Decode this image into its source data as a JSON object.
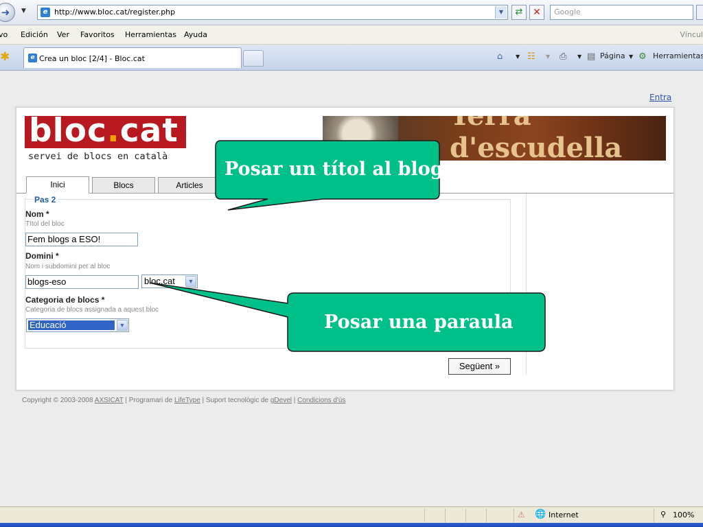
{
  "browser": {
    "url": "http://www.bloc.cat/register.php",
    "search_placeholder": "Google",
    "menu": [
      "vo",
      "Edición",
      "Ver",
      "Favoritos",
      "Herramientas",
      "Ayuda"
    ],
    "menu_right": "Víncul",
    "tab_title": "Crea un bloc [2/4] - Bloc.cat",
    "cmd_page": "Página",
    "cmd_tools": "Herramientas"
  },
  "site": {
    "login_link": "Entra",
    "logo_part1": "bloc",
    "logo_dot": ".",
    "logo_part2": "cat",
    "logo_sub": "servei de blocs en català",
    "banner_text": "Terra d'escudella",
    "nav_tabs": [
      "Inici",
      "Blocs",
      "Articles"
    ]
  },
  "form": {
    "legend": "Pas 2",
    "nom_label": "Nom *",
    "nom_hint": "Títol del bloc",
    "nom_value": "Fem blogs a ESO!",
    "domini_label": "Domini *",
    "domini_hint": "Nom i subdomini per al bloc",
    "domini_value": "blogs-eso",
    "domini_select": "bloc.cat",
    "categoria_label": "Categoria de blocs *",
    "categoria_hint": "Categoria de blocs assignada a aquest bloc",
    "categoria_value": "Educació",
    "next_button": "Següent »"
  },
  "footer": {
    "prefix": "Copyright © 2003-2008 ",
    "axsicat": "AXSICAT",
    "sep1": " | Programari de ",
    "lifetype": "LifeType",
    "sep2": " | Suport tecnològic de ",
    "gdevel": "gDevel",
    "sep3": " | ",
    "conditions": "Condicions d'ús"
  },
  "callouts": {
    "title_hint": "Posar un títol al blog",
    "word_hint": "Posar una paraula",
    "fill_color": "#00c08a"
  },
  "status": {
    "zone": "Internet",
    "zoom": "100%"
  }
}
